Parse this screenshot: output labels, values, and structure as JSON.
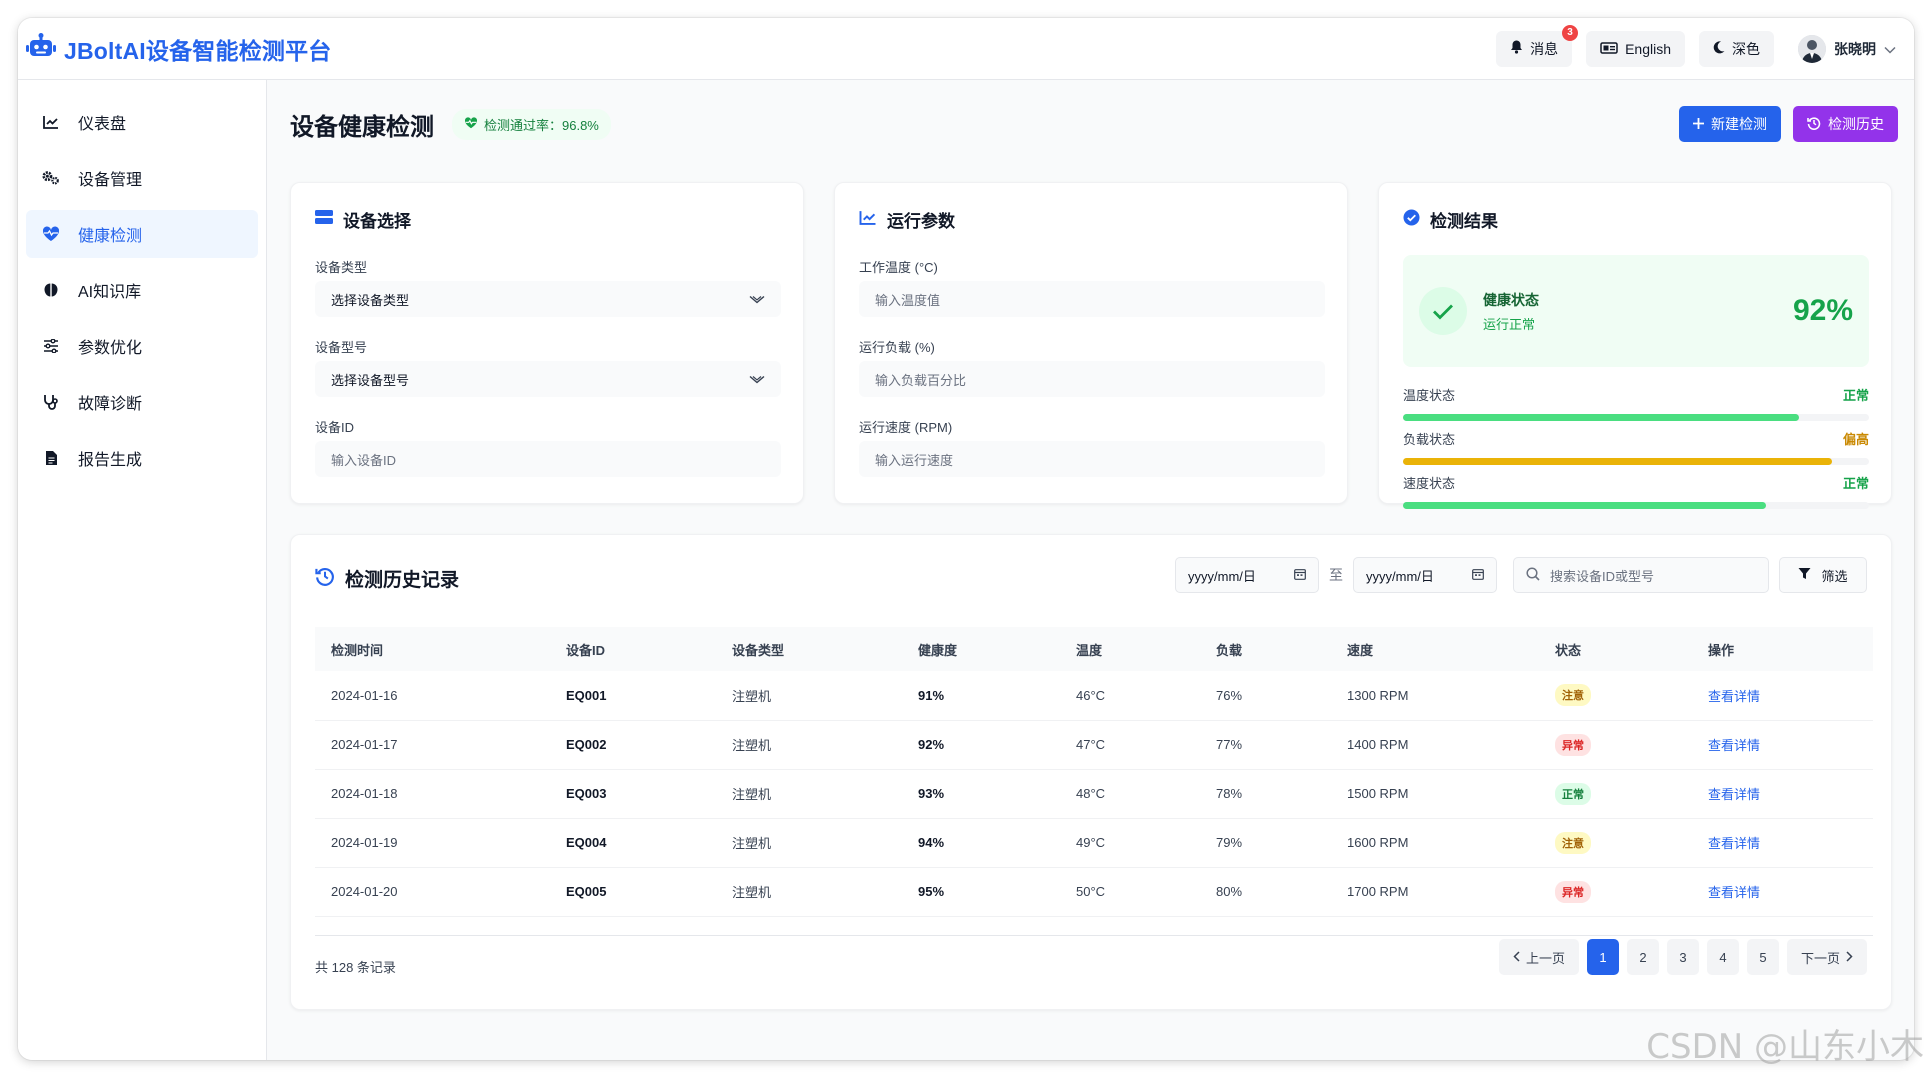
{
  "app": {
    "title": "JBoltAI设备智能检测平台"
  },
  "header": {
    "messages_label": "消息",
    "messages_count": "3",
    "language_label": "English",
    "theme_label": "深色",
    "user_name": "张晓明"
  },
  "sidebar": {
    "items": [
      {
        "label": "仪表盘",
        "icon": "chart-line-icon"
      },
      {
        "label": "设备管理",
        "icon": "gears-icon"
      },
      {
        "label": "健康检测",
        "icon": "heartbeat-icon"
      },
      {
        "label": "AI知识库",
        "icon": "brain-icon"
      },
      {
        "label": "参数优化",
        "icon": "sliders-icon"
      },
      {
        "label": "故障诊断",
        "icon": "stethoscope-icon"
      },
      {
        "label": "报告生成",
        "icon": "file-icon"
      }
    ],
    "active_index": 2
  },
  "page": {
    "title": "设备健康检测",
    "pass_rate": "检测通过率：96.8%",
    "new_button": "新建检测",
    "history_button": "检测历史"
  },
  "device_select": {
    "title": "设备选择",
    "type_label": "设备类型",
    "type_value": "选择设备类型",
    "model_label": "设备型号",
    "model_value": "选择设备型号",
    "id_label": "设备ID",
    "id_placeholder": "输入设备ID"
  },
  "params": {
    "title": "运行参数",
    "temp_label": "工作温度 (°C)",
    "temp_placeholder": "输入温度值",
    "load_label": "运行负载 (%)",
    "load_placeholder": "输入负载百分比",
    "speed_label": "运行速度 (RPM)",
    "speed_placeholder": "输入运行速度"
  },
  "result": {
    "title": "检测结果",
    "health_title": "健康状态",
    "health_sub": "运行正常",
    "score": "92%",
    "metrics": [
      {
        "label": "温度状态",
        "status": "正常",
        "level": 0.85,
        "color": "#4ade80",
        "status_color": "#16a34a"
      },
      {
        "label": "负载状态",
        "status": "偏高",
        "level": 0.92,
        "color": "#eab308",
        "status_color": "#ca8a04"
      },
      {
        "label": "速度状态",
        "status": "正常",
        "level": 0.78,
        "color": "#4ade80",
        "status_color": "#16a34a"
      }
    ]
  },
  "history": {
    "title": "检测历史记录",
    "date_placeholder_start": "yyyy/mm/日",
    "date_sep": "至",
    "date_placeholder_end": "yyyy/mm/日",
    "search_placeholder": "搜索设备ID或型号",
    "filter_label": "筛选",
    "columns": [
      "检测时间",
      "设备ID",
      "设备类型",
      "健康度",
      "温度",
      "负载",
      "速度",
      "状态",
      "操作"
    ],
    "rows": [
      {
        "date": "2024-01-16",
        "id": "EQ001",
        "type": "注塑机",
        "health": "91%",
        "temp": "46°C",
        "load": "76%",
        "speed": "1300 RPM",
        "status": "注意",
        "status_kind": "warn",
        "action": "查看详情"
      },
      {
        "date": "2024-01-17",
        "id": "EQ002",
        "type": "注塑机",
        "health": "92%",
        "temp": "47°C",
        "load": "77%",
        "speed": "1400 RPM",
        "status": "异常",
        "status_kind": "error",
        "action": "查看详情"
      },
      {
        "date": "2024-01-18",
        "id": "EQ003",
        "type": "注塑机",
        "health": "93%",
        "temp": "48°C",
        "load": "78%",
        "speed": "1500 RPM",
        "status": "正常",
        "status_kind": "ok",
        "action": "查看详情"
      },
      {
        "date": "2024-01-19",
        "id": "EQ004",
        "type": "注塑机",
        "health": "94%",
        "temp": "49°C",
        "load": "79%",
        "speed": "1600 RPM",
        "status": "注意",
        "status_kind": "warn",
        "action": "查看详情"
      },
      {
        "date": "2024-01-20",
        "id": "EQ005",
        "type": "注塑机",
        "health": "95%",
        "temp": "50°C",
        "load": "80%",
        "speed": "1700 RPM",
        "status": "异常",
        "status_kind": "error",
        "action": "查看详情"
      }
    ],
    "total": "共 128 条记录",
    "prev": "上一页",
    "next": "下一页",
    "pages": [
      "1",
      "2",
      "3",
      "4",
      "5"
    ],
    "current_page": "1"
  },
  "status_colors": {
    "warn": {
      "bg": "#fef9c3",
      "fg": "#a16207"
    },
    "error": {
      "bg": "#fee2e2",
      "fg": "#dc2626"
    },
    "ok": {
      "bg": "#dcfce7",
      "fg": "#15803d"
    }
  },
  "accent": "#2563eb",
  "watermark": "CSDN @山东小木"
}
